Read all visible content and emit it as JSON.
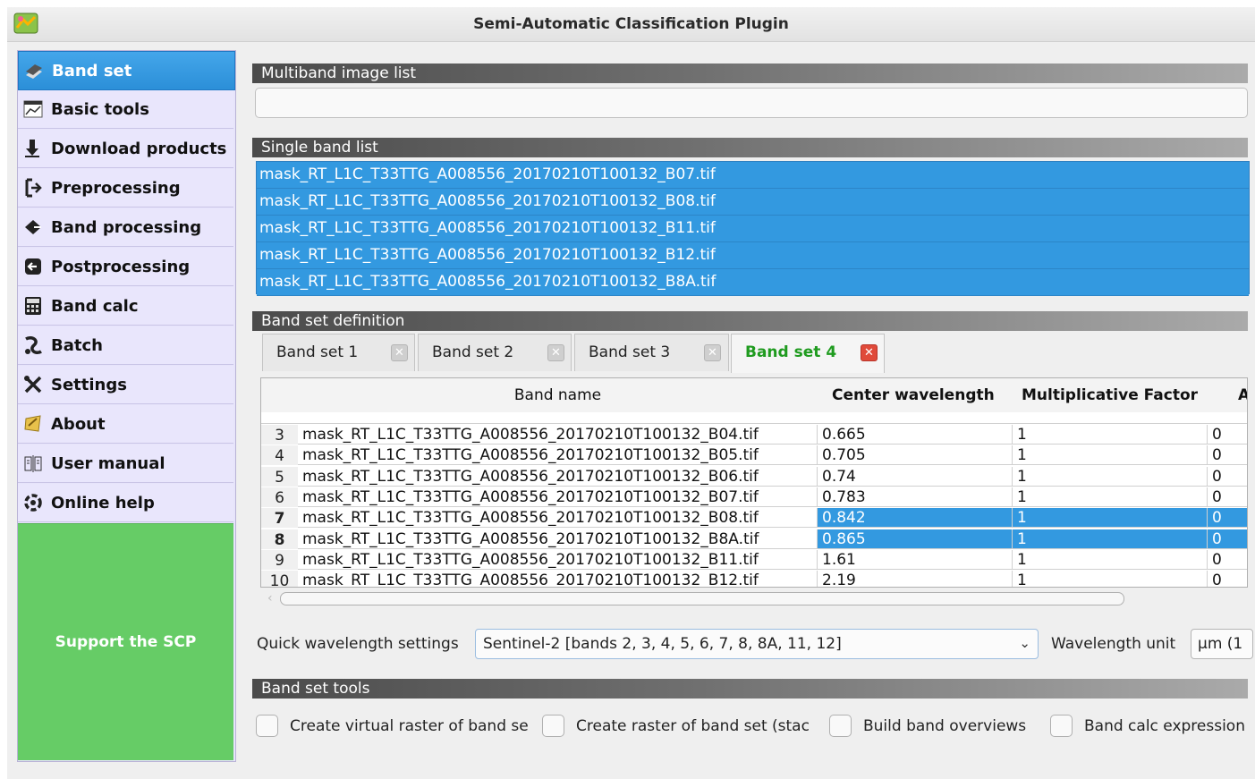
{
  "window": {
    "title": "Semi-Automatic Classification Plugin"
  },
  "sidebar": {
    "items": [
      {
        "label": "Band set",
        "icon": "band-set-icon",
        "active": true
      },
      {
        "label": "Basic tools",
        "icon": "chart-icon"
      },
      {
        "label": "Download products",
        "icon": "download-icon"
      },
      {
        "label": "Preprocessing",
        "icon": "preprocessing-icon"
      },
      {
        "label": "Band processing",
        "icon": "band-processing-icon"
      },
      {
        "label": "Postprocessing",
        "icon": "postprocessing-icon"
      },
      {
        "label": "Band calc",
        "icon": "calculator-icon"
      },
      {
        "label": "Batch",
        "icon": "batch-icon"
      },
      {
        "label": "Settings",
        "icon": "tools-icon"
      },
      {
        "label": "About",
        "icon": "about-icon"
      },
      {
        "label": "User manual",
        "icon": "manual-icon"
      },
      {
        "label": "Online help",
        "icon": "help-icon"
      }
    ],
    "support_label": "Support the SCP",
    "support_color": "#66cc66",
    "accent_color": "#3399e0"
  },
  "sections": {
    "multiband": "Multiband image list",
    "single": "Single band list",
    "definition": "Band set definition",
    "tools": "Band set tools"
  },
  "single_band_list": [
    "mask_RT_L1C_T33TTG_A008556_20170210T100132_B07.tif",
    "mask_RT_L1C_T33TTG_A008556_20170210T100132_B08.tif",
    "mask_RT_L1C_T33TTG_A008556_20170210T100132_B11.tif",
    "mask_RT_L1C_T33TTG_A008556_20170210T100132_B12.tif",
    "mask_RT_L1C_T33TTG_A008556_20170210T100132_B8A.tif"
  ],
  "tabs": [
    {
      "label": "Band set 1",
      "active": false
    },
    {
      "label": "Band set 2",
      "active": false
    },
    {
      "label": "Band set 3",
      "active": false
    },
    {
      "label": "Band set 4",
      "active": true
    }
  ],
  "table": {
    "headers": [
      "Band name",
      "Center wavelength",
      "Multiplicative Factor",
      "A"
    ],
    "rows": [
      {
        "num": "3",
        "name": "mask_RT_L1C_T33TTG_A008556_20170210T100132_B04.tif",
        "wl": "0.665",
        "mult": "1",
        "add": "0",
        "selected": false
      },
      {
        "num": "4",
        "name": "mask_RT_L1C_T33TTG_A008556_20170210T100132_B05.tif",
        "wl": "0.705",
        "mult": "1",
        "add": "0",
        "selected": false
      },
      {
        "num": "5",
        "name": "mask_RT_L1C_T33TTG_A008556_20170210T100132_B06.tif",
        "wl": "0.74",
        "mult": "1",
        "add": "0",
        "selected": false
      },
      {
        "num": "6",
        "name": "mask_RT_L1C_T33TTG_A008556_20170210T100132_B07.tif",
        "wl": "0.783",
        "mult": "1",
        "add": "0",
        "selected": false
      },
      {
        "num": "7",
        "name": "mask_RT_L1C_T33TTG_A008556_20170210T100132_B08.tif",
        "wl": "0.842",
        "mult": "1",
        "add": "0",
        "selected": true
      },
      {
        "num": "8",
        "name": "mask_RT_L1C_T33TTG_A008556_20170210T100132_B8A.tif",
        "wl": "0.865",
        "mult": "1",
        "add": "0",
        "selected": true
      },
      {
        "num": "9",
        "name": "mask_RT_L1C_T33TTG_A008556_20170210T100132_B11.tif",
        "wl": "1.61",
        "mult": "1",
        "add": "0",
        "selected": false
      },
      {
        "num": "10",
        "name": "mask_RT_L1C_T33TTG_A008556_20170210T100132_B12.tif",
        "wl": "2.19",
        "mult": "1",
        "add": "0",
        "selected": false
      }
    ]
  },
  "quick_wavelength": {
    "label": "Quick wavelength settings",
    "value": "Sentinel-2 [bands 2, 3, 4, 5, 6, 7, 8, 8A, 11, 12]"
  },
  "wavelength_unit": {
    "label": "Wavelength unit",
    "value": "µm (1"
  },
  "tools": {
    "checkboxes": [
      "Create virtual raster of band se",
      "Create raster of band set (stac",
      "Build band overviews",
      "Band calc expression"
    ]
  }
}
